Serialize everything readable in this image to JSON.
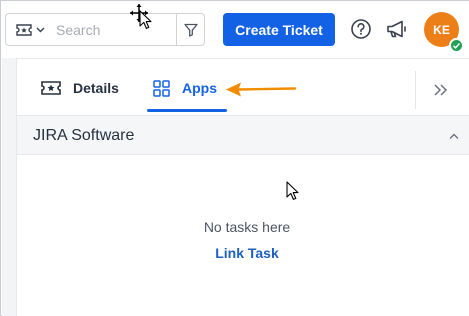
{
  "topbar": {
    "search": {
      "type_icon": "ticket-icon",
      "placeholder": "Search",
      "value": "",
      "filter_icon": "filter-icon"
    },
    "create_ticket_label": "Create Ticket",
    "help_icon": "help-circle-icon",
    "announcements_icon": "megaphone-icon",
    "avatar": {
      "initials": "KE",
      "color": "#ec7f18",
      "status": "online",
      "status_color": "#21a155"
    }
  },
  "tabs": [
    {
      "label": "Details",
      "icon": "ticket-icon",
      "active": false
    },
    {
      "label": "Apps",
      "icon": "grid-icon",
      "active": true
    }
  ],
  "accent_color": "#1362e6",
  "collapse_icon": "double-chevron-right-icon",
  "annotation": {
    "type": "arrow",
    "color": "#f28c00",
    "points_to": "Apps"
  },
  "panel": {
    "title": "JIRA Software",
    "expanded": true,
    "empty_message": "No tasks here",
    "link_label": "Link Task"
  }
}
